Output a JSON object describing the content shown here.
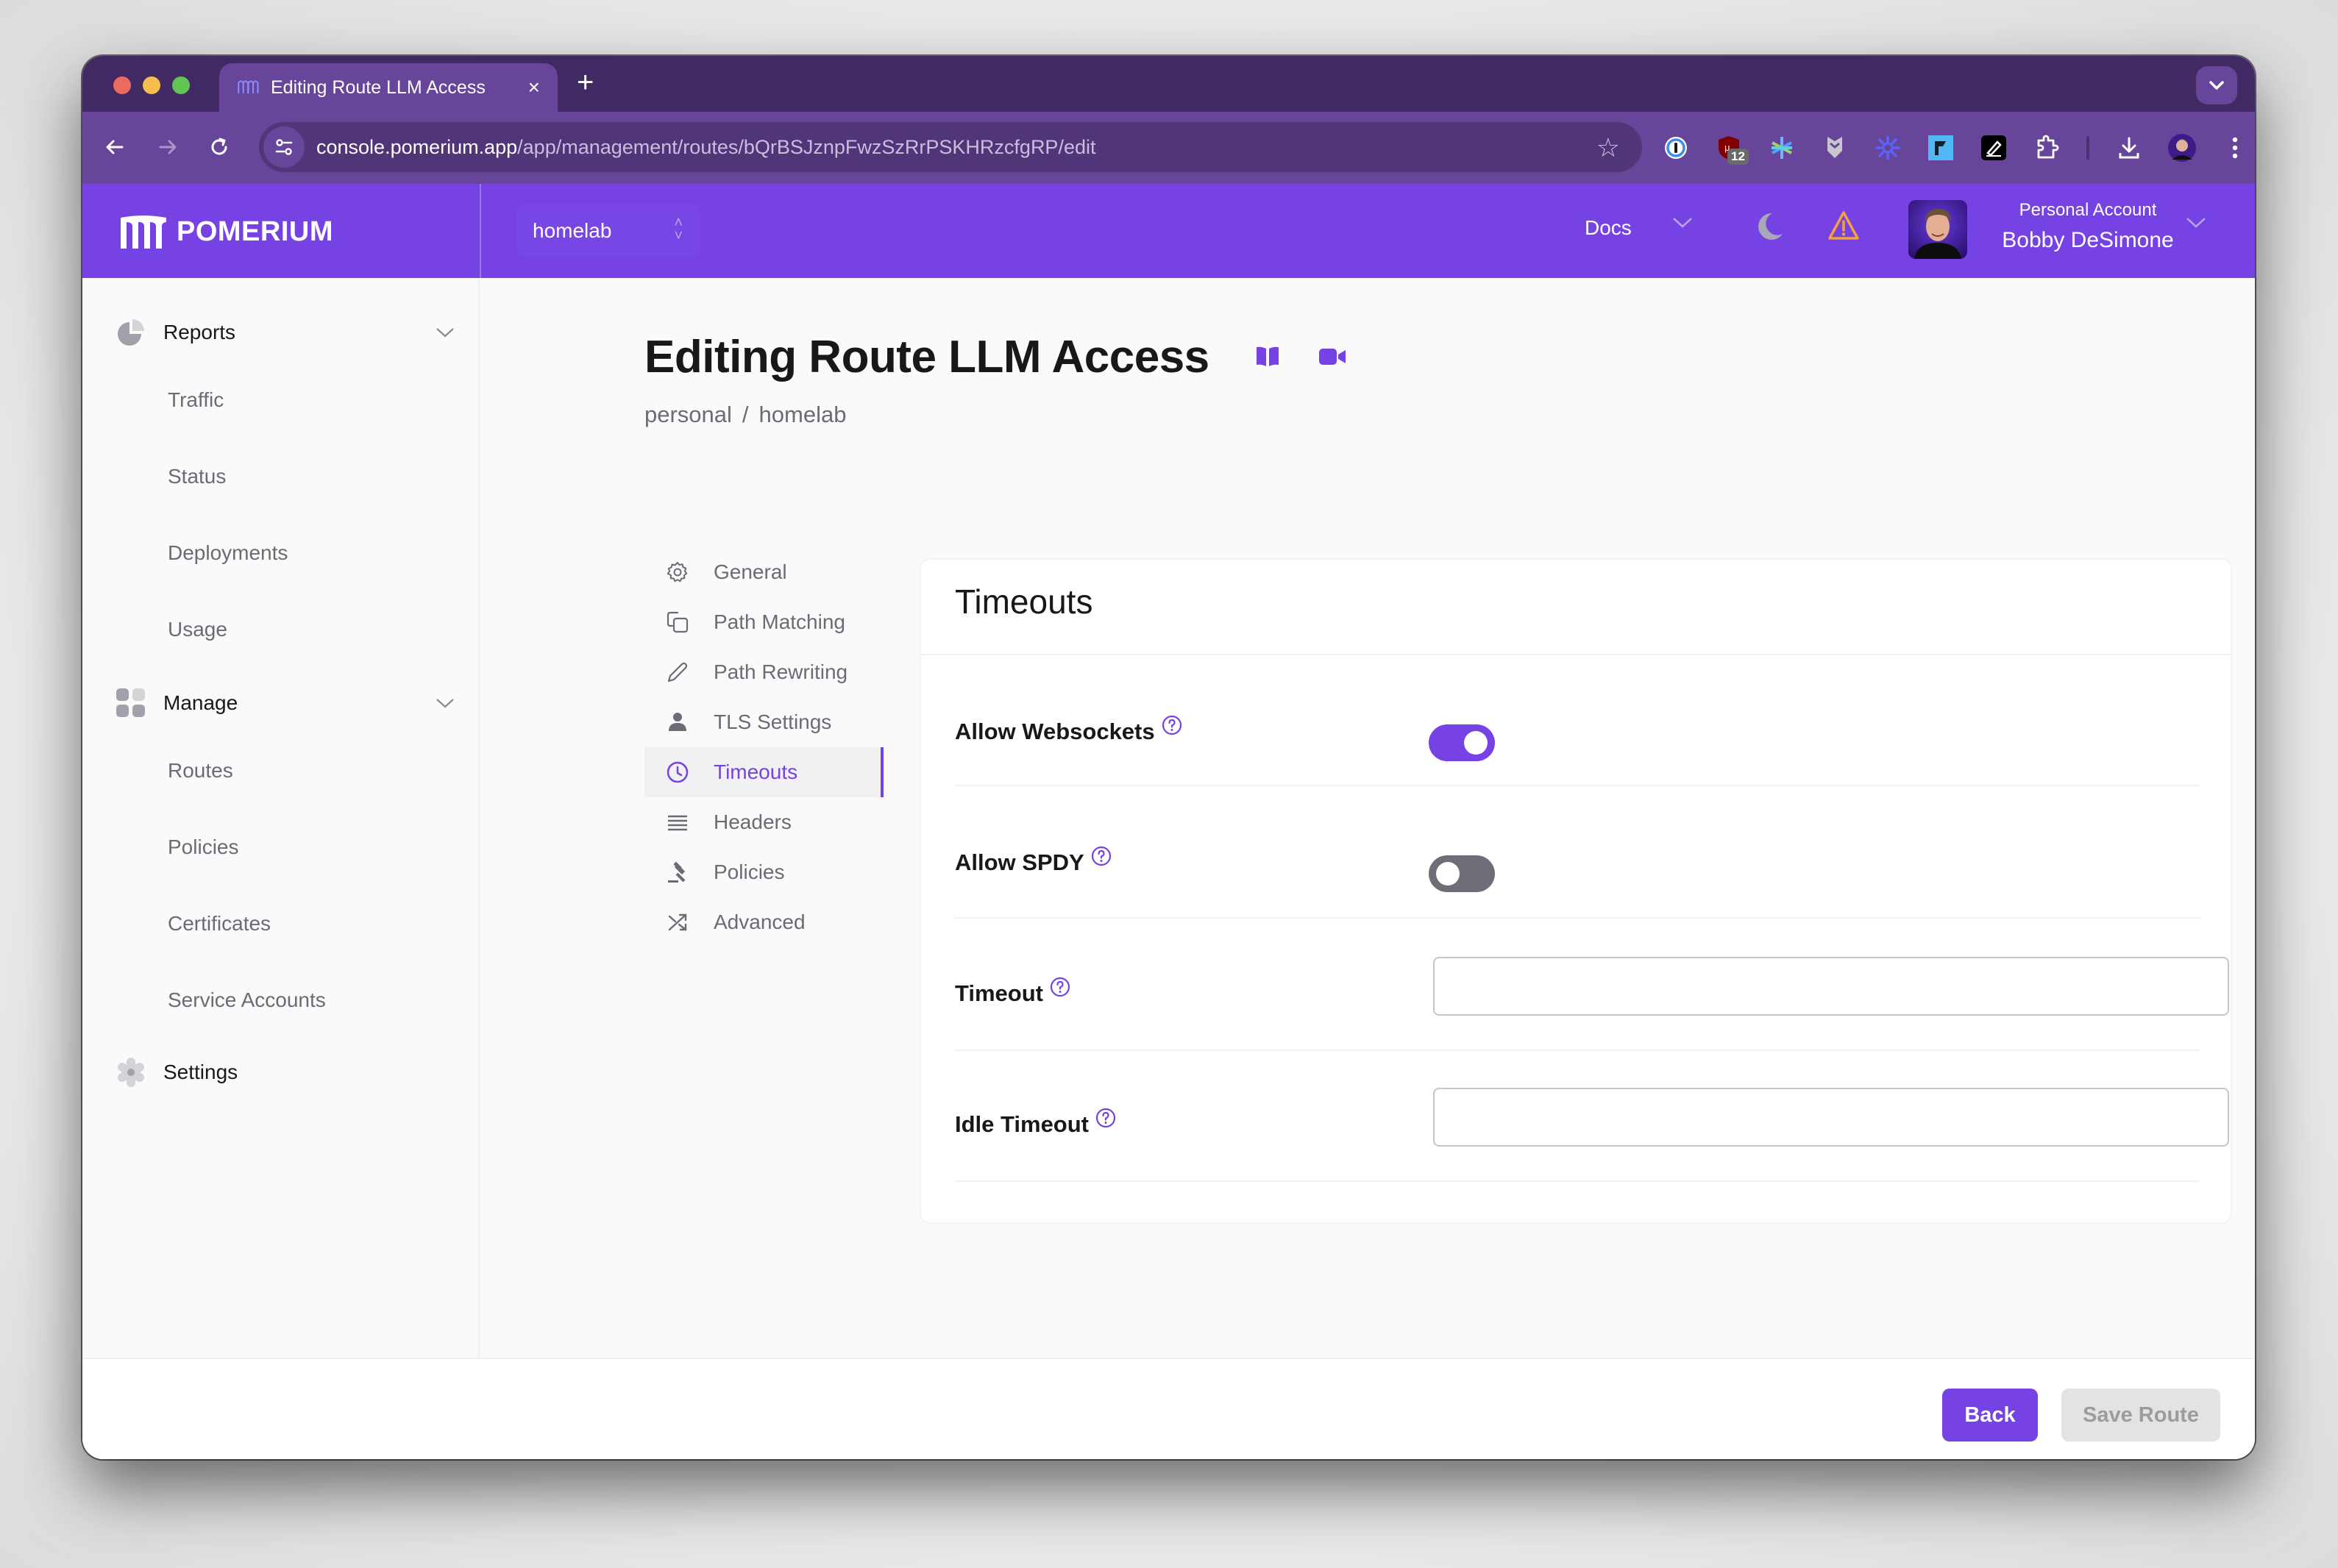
{
  "browser": {
    "tab": {
      "title": "Editing Route LLM Access",
      "favicon": "pomerium-logo-icon",
      "close": "×"
    },
    "new_tab": "+",
    "tab_search": "chevron-down-icon",
    "nav": {
      "back": "←",
      "forward": "→",
      "reload": "⟳"
    },
    "url": {
      "host": "console.pomerium.app",
      "path": "/app/management/routes/bQrBSJznpFwzSzRrPSKHRzcfgRP/edit"
    },
    "bookmark": "☆",
    "extensions": [
      {
        "name": "1password-extension-icon"
      },
      {
        "name": "ublock-extension-icon",
        "badge": "12"
      },
      {
        "name": "perplexity-extension-icon"
      },
      {
        "name": "shield-extension-icon"
      },
      {
        "name": "sparkle-extension-icon"
      },
      {
        "name": "linear-extension-icon"
      },
      {
        "name": "pen-extension-icon"
      },
      {
        "name": "puzzle-extensions-icon"
      },
      {
        "name": "download-icon"
      },
      {
        "name": "profile-avatar-icon"
      },
      {
        "name": "more-menu-icon"
      }
    ]
  },
  "header": {
    "brand": "POMERIUM",
    "org": "homelab",
    "docs": "Docs",
    "account_label": "Personal Account",
    "account_name": "Bobby DeSimone",
    "colors": {
      "brand": "#7642e3",
      "warning": "#f2a33a"
    }
  },
  "sidebar": {
    "sections": [
      {
        "label": "Reports",
        "icon": "pie-chart-icon",
        "expanded": true,
        "items": [
          "Traffic",
          "Status",
          "Deployments",
          "Usage"
        ]
      },
      {
        "label": "Manage",
        "icon": "grid-icon",
        "expanded": true,
        "items": [
          "Routes",
          "Policies",
          "Certificates",
          "Service Accounts"
        ]
      },
      {
        "label": "Settings",
        "icon": "settings-icon"
      }
    ]
  },
  "page": {
    "title": "Editing Route LLM Access",
    "breadcrumb": [
      "personal",
      "homelab"
    ],
    "breadcrumb_sep": "/",
    "subnav": [
      {
        "label": "General",
        "icon": "gear-icon",
        "active": false
      },
      {
        "label": "Path Matching",
        "icon": "copy-icon",
        "active": false
      },
      {
        "label": "Path Rewriting",
        "icon": "pencil-icon",
        "active": false
      },
      {
        "label": "TLS Settings",
        "icon": "user-icon",
        "active": false
      },
      {
        "label": "Timeouts",
        "icon": "clock-icon",
        "active": true
      },
      {
        "label": "Headers",
        "icon": "lines-icon",
        "active": false
      },
      {
        "label": "Policies",
        "icon": "gavel-icon",
        "active": false
      },
      {
        "label": "Advanced",
        "icon": "shuffle-icon",
        "active": false
      }
    ],
    "card": {
      "title": "Timeouts",
      "fields": [
        {
          "label": "Allow Websockets",
          "type": "toggle",
          "value": true
        },
        {
          "label": "Allow SPDY",
          "type": "toggle",
          "value": false
        },
        {
          "label": "Timeout",
          "type": "text",
          "value": "",
          "placeholder": ""
        },
        {
          "label": "Idle Timeout",
          "type": "text",
          "value": "",
          "placeholder": ""
        }
      ]
    }
  },
  "footer": {
    "back": "Back",
    "save": "Save Route",
    "save_disabled": true
  }
}
